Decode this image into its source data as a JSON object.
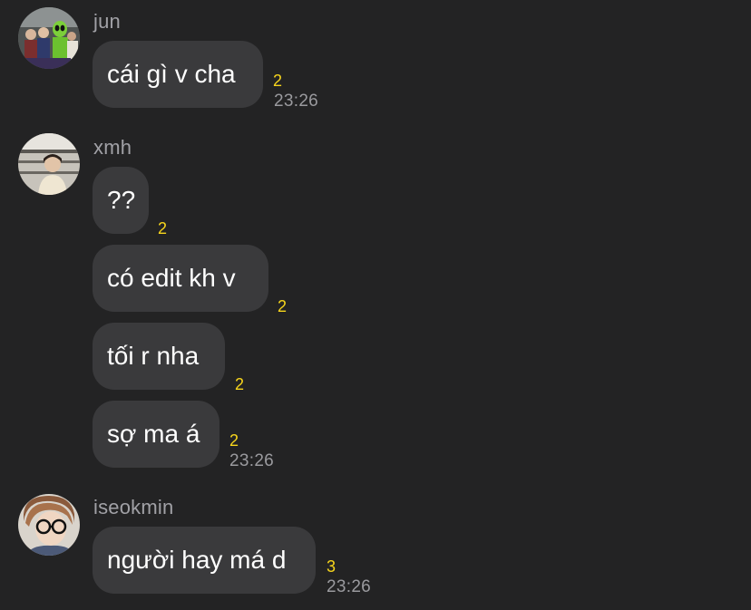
{
  "colors": {
    "background": "#232324",
    "bubble": "#3a3a3c",
    "message_text": "#ffffff",
    "sender_name": "#a1a1a6",
    "unread_count": "#f7d51c",
    "timestamp": "#9a9a9e"
  },
  "groups": [
    {
      "sender": "jun",
      "avatar_icon": "group-photo-avatar",
      "messages": [
        {
          "text": "cái gì v cha",
          "unread": "2",
          "time": "23:26"
        }
      ]
    },
    {
      "sender": "xmh",
      "avatar_icon": "person-photo-avatar",
      "messages": [
        {
          "text": "??",
          "unread": "2"
        },
        {
          "text": "có edit kh v",
          "unread": "2"
        },
        {
          "text": "tối r nha",
          "unread": "2"
        },
        {
          "text": "sợ ma á",
          "unread": "2",
          "time": "23:26"
        }
      ]
    },
    {
      "sender": "iseokmin",
      "avatar_icon": "glasses-person-avatar",
      "messages": [
        {
          "text": "người hay má d",
          "unread": "3",
          "time": "23:26"
        }
      ]
    }
  ]
}
